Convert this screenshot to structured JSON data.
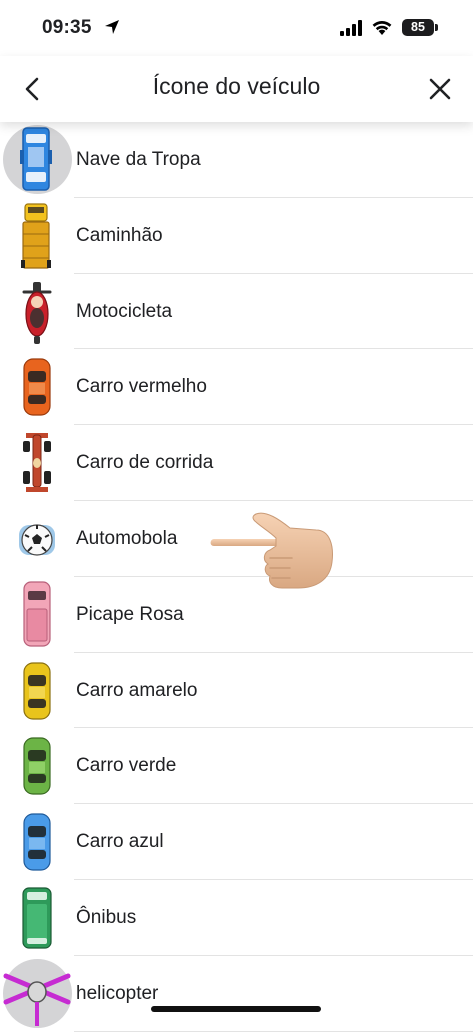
{
  "status_bar": {
    "time": "09:35",
    "battery": "85"
  },
  "header": {
    "title": "Ícone do veículo"
  },
  "list": [
    {
      "label": "Nave da Tropa",
      "icon": "troop-ship-icon",
      "selected": true
    },
    {
      "label": "Caminhão",
      "icon": "truck-icon"
    },
    {
      "label": "Motocicleta",
      "icon": "motorcycle-icon"
    },
    {
      "label": "Carro vermelho",
      "icon": "red-car-icon"
    },
    {
      "label": "Carro de corrida",
      "icon": "race-car-icon"
    },
    {
      "label": "Automobola",
      "icon": "soccer-ball-car-icon"
    },
    {
      "label": "Picape Rosa",
      "icon": "pink-pickup-icon"
    },
    {
      "label": "Carro amarelo",
      "icon": "yellow-car-icon"
    },
    {
      "label": "Carro verde",
      "icon": "green-car-icon"
    },
    {
      "label": "Carro azul",
      "icon": "blue-car-icon"
    },
    {
      "label": "Ônibus",
      "icon": "bus-icon"
    },
    {
      "label": "helicopter",
      "icon": "helicopter-icon"
    }
  ],
  "colors": {
    "troop_ship": "#2f86e0",
    "truck": "#e0a21a",
    "motorcycle": "#c8202a",
    "red_car": "#e8641e",
    "race_car": "#c0472c",
    "pink_pickup": "#f2a6b8",
    "yellow_car": "#e9c41c",
    "green_car": "#6cb446",
    "blue_car": "#4a9be8",
    "bus": "#2e9a5a",
    "helicopter": "#c62bd2",
    "divider": "#e3e3e3"
  }
}
